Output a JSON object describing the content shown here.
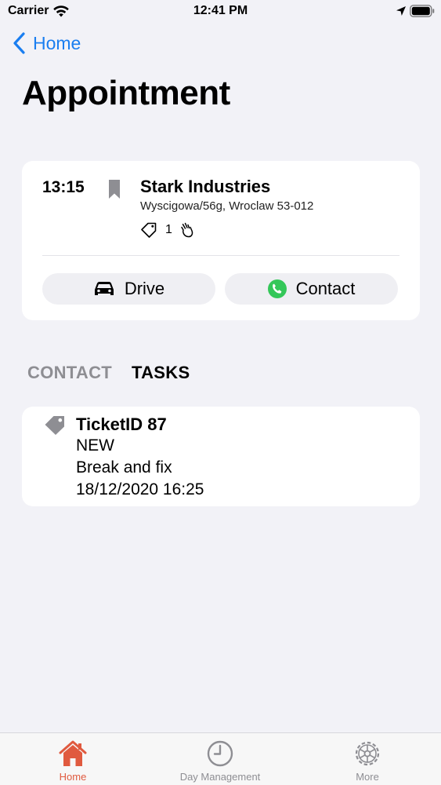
{
  "status_bar": {
    "carrier": "Carrier",
    "time": "12:41 PM"
  },
  "nav": {
    "back_label": "Home",
    "title": "Appointment"
  },
  "appointment": {
    "time": "13:15",
    "company": "Stark Industries",
    "address": "Wyscigowa/56g, Wroclaw 53-012",
    "ticket_count": "1",
    "drive_label": "Drive",
    "contact_label": "Contact"
  },
  "tabs": [
    {
      "label": "CONTACT",
      "selected": false
    },
    {
      "label": "TASKS",
      "selected": true
    }
  ],
  "task": {
    "id": "TicketID 87",
    "status": "NEW",
    "description": "Break and fix",
    "date": "18/12/2020 16:25"
  },
  "tab_bar": {
    "items": [
      {
        "label": "Home",
        "icon": "house-icon",
        "active": true
      },
      {
        "label": "Day Management",
        "icon": "clock-icon",
        "active": false
      },
      {
        "label": "More",
        "icon": "gear-icon",
        "active": false
      }
    ]
  },
  "colors": {
    "accent": "#1a7ef0",
    "active_tab": "#e05a3f",
    "inactive": "#8e8e93",
    "phone_green": "#34c759"
  }
}
